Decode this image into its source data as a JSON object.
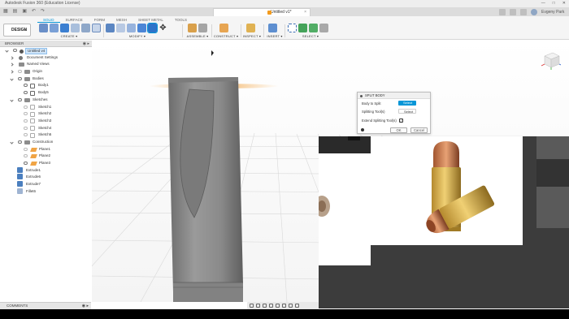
{
  "window": {
    "title": "Autodesk Fusion 360 (Education License)",
    "controls": [
      "—",
      "□",
      "✕"
    ]
  },
  "tabbar": {
    "document_tab": "Untitled v1*",
    "user": "Evgeny Park"
  },
  "ribbon": {
    "workspace": "DESIGN",
    "tabs": [
      {
        "label": "SOLID",
        "active": true
      },
      {
        "label": "SURFACE",
        "active": false
      },
      {
        "label": "FORM",
        "active": false
      },
      {
        "label": "MESH",
        "active": false
      },
      {
        "label": "SHEET METAL",
        "active": false
      },
      {
        "label": "TOOLS",
        "active": false
      }
    ],
    "groups": {
      "create": "CREATE ▾",
      "modify": "MODIFY ▾",
      "assemble": "ASSEMBLE ▾",
      "construct": "CONSTRUCT ▾",
      "inspect": "INSPECT ▾",
      "insert": "INSERT ▾",
      "select": "SELECT ▾"
    }
  },
  "browser": {
    "header": "BROWSER",
    "root": "Untitled v4",
    "items": {
      "document_settings": "Document Settings",
      "named_views": "Named Views",
      "origin": "Origin",
      "bodies": "Bodies",
      "body1": "Body1",
      "body5": "Body5",
      "sketches": "Sketches",
      "sketch1": "Sketch1",
      "sketch2": "Sketch2",
      "sketch3": "Sketch3",
      "sketch4": "Sketch4",
      "sketch5": "Sketch5",
      "construction": "Construction",
      "plane1": "Plane1",
      "plane2": "Plane2",
      "plane3": "Plane3",
      "extrude1": "Extrude1",
      "extrude6": "Extrude6",
      "extrude7": "Extrude7",
      "fillet6": "Fillet6"
    }
  },
  "dialog": {
    "title": "SPLIT BODY",
    "body_to_split_label": "Body to Split",
    "body_to_split_button": "Select",
    "splitting_tools_label": "Splitting Tool(s)",
    "splitting_tools_button": "Select",
    "extend_label": "Extend Splitting Tool(s)",
    "extend_checked": "✓",
    "ok": "OK",
    "cancel": "Cancel"
  },
  "comments": {
    "label": "COMMENTS"
  },
  "colors": {
    "accent": "#0696d7",
    "plane": "#f0a445",
    "body": "#8a8a8a"
  }
}
